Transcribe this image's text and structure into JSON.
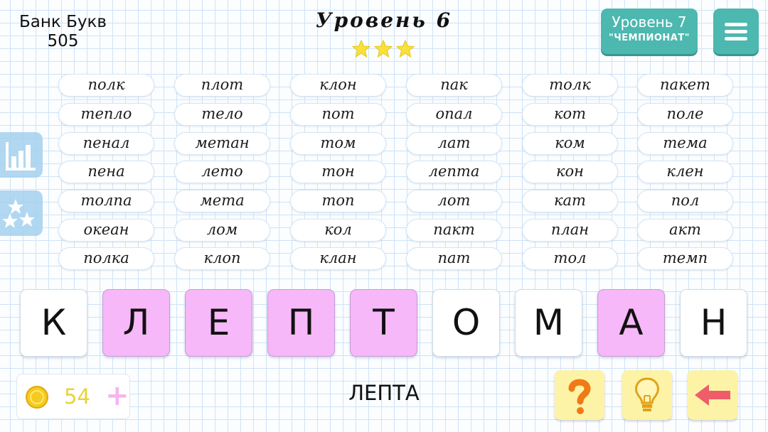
{
  "header": {
    "bank_label": "Банк Букв",
    "bank_count": "505",
    "level_title": "Уровень 6",
    "stars_earned": 3,
    "stars_total": 3,
    "next_level_line1": "Уровень 7",
    "next_level_line2": "\"ЧЕМПИОНАТ\""
  },
  "words": [
    [
      "полк",
      "тепло",
      "пенал",
      "пена",
      "толпа",
      "океан",
      "полка"
    ],
    [
      "плот",
      "тело",
      "метан",
      "лето",
      "мета",
      "лом",
      "клоп"
    ],
    [
      "клон",
      "пот",
      "том",
      "тон",
      "топ",
      "кол",
      "клан"
    ],
    [
      "пак",
      "опал",
      "лат",
      "лепта",
      "лот",
      "пакт",
      "пат"
    ],
    [
      "толк",
      "кот",
      "ком",
      "кон",
      "кат",
      "план",
      "тол"
    ],
    [
      "пакет",
      "поле",
      "тема",
      "клен",
      "пол",
      "акт",
      "темп"
    ]
  ],
  "tiles": [
    {
      "letter": "К",
      "selected": false
    },
    {
      "letter": "Л",
      "selected": true
    },
    {
      "letter": "Е",
      "selected": true
    },
    {
      "letter": "П",
      "selected": true
    },
    {
      "letter": "Т",
      "selected": true
    },
    {
      "letter": "О",
      "selected": false
    },
    {
      "letter": "М",
      "selected": false
    },
    {
      "letter": "А",
      "selected": true
    },
    {
      "letter": "Н",
      "selected": false
    }
  ],
  "current_word": "ЛЕПТА",
  "coins": {
    "count": "54"
  },
  "icons": {
    "side_top": "bar-chart-icon",
    "side_bottom": "stars-icon",
    "coin": "coin-icon",
    "plus": "plus-icon",
    "question": "question-icon",
    "hint": "lightbulb-icon",
    "back": "arrow-left-icon",
    "menu": "menu-icon"
  },
  "colors": {
    "accent": "#4cb8b0",
    "selected_tile": "#f6b8f8",
    "action_button": "#fdf3a6",
    "question_mark": "#f07a16",
    "arrow": "#ef5d6a",
    "star": "#f9e13a"
  }
}
